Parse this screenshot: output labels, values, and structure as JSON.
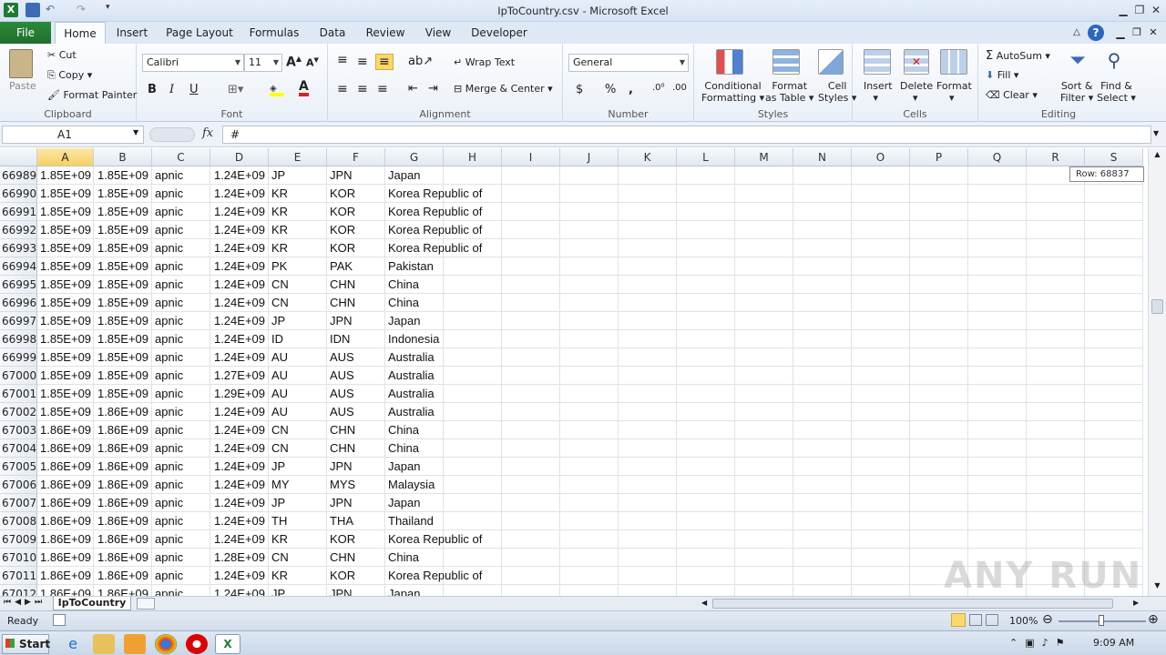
{
  "window": {
    "title": "IpToCountry.csv - Microsoft Excel"
  },
  "tabs": {
    "file": "File",
    "items": [
      "Home",
      "Insert",
      "Page Layout",
      "Formulas",
      "Data",
      "Review",
      "View",
      "Developer"
    ]
  },
  "ribbon": {
    "clipboard": {
      "label": "Clipboard",
      "paste": "Paste",
      "cut": "Cut",
      "copy": "Copy",
      "format_painter": "Format Painter"
    },
    "font": {
      "label": "Font",
      "family": "Calibri",
      "size": "11",
      "bold": "B",
      "italic": "I",
      "underline": "U"
    },
    "alignment": {
      "label": "Alignment",
      "wrap": "Wrap Text",
      "merge": "Merge & Center"
    },
    "number": {
      "label": "Number",
      "format": "General",
      "currency": "$",
      "percent": "%",
      "comma": ","
    },
    "styles": {
      "label": "Styles",
      "cond1": "Conditional",
      "cond2": "Formatting",
      "fmt1": "Format",
      "fmt2": "as Table",
      "cell1": "Cell",
      "cell2": "Styles"
    },
    "cells": {
      "label": "Cells",
      "insert": "Insert",
      "delete": "Delete",
      "format": "Format"
    },
    "editing": {
      "label": "Editing",
      "autosum": "AutoSum",
      "fill": "Fill",
      "clear": "Clear",
      "sort1": "Sort &",
      "sort2": "Filter",
      "find1": "Find &",
      "find2": "Select"
    }
  },
  "formula_bar": {
    "name_box": "A1",
    "fx": "fx",
    "content": "#"
  },
  "grid": {
    "columns": [
      "A",
      "B",
      "C",
      "D",
      "E",
      "F",
      "G",
      "H",
      "I",
      "J",
      "K",
      "L",
      "M",
      "N",
      "O",
      "P",
      "Q",
      "R",
      "S"
    ],
    "tooltip": "Row: 68837",
    "rows": [
      {
        "n": "66989",
        "a": "1.85E+09",
        "b": "1.85E+09",
        "c": "apnic",
        "d": "1.24E+09",
        "e": "JP",
        "f": "JPN",
        "g": "Japan"
      },
      {
        "n": "66990",
        "a": "1.85E+09",
        "b": "1.85E+09",
        "c": "apnic",
        "d": "1.24E+09",
        "e": "KR",
        "f": "KOR",
        "g": "Korea Republic of"
      },
      {
        "n": "66991",
        "a": "1.85E+09",
        "b": "1.85E+09",
        "c": "apnic",
        "d": "1.24E+09",
        "e": "KR",
        "f": "KOR",
        "g": "Korea Republic of"
      },
      {
        "n": "66992",
        "a": "1.85E+09",
        "b": "1.85E+09",
        "c": "apnic",
        "d": "1.24E+09",
        "e": "KR",
        "f": "KOR",
        "g": "Korea Republic of"
      },
      {
        "n": "66993",
        "a": "1.85E+09",
        "b": "1.85E+09",
        "c": "apnic",
        "d": "1.24E+09",
        "e": "KR",
        "f": "KOR",
        "g": "Korea Republic of"
      },
      {
        "n": "66994",
        "a": "1.85E+09",
        "b": "1.85E+09",
        "c": "apnic",
        "d": "1.24E+09",
        "e": "PK",
        "f": "PAK",
        "g": "Pakistan"
      },
      {
        "n": "66995",
        "a": "1.85E+09",
        "b": "1.85E+09",
        "c": "apnic",
        "d": "1.24E+09",
        "e": "CN",
        "f": "CHN",
        "g": "China"
      },
      {
        "n": "66996",
        "a": "1.85E+09",
        "b": "1.85E+09",
        "c": "apnic",
        "d": "1.24E+09",
        "e": "CN",
        "f": "CHN",
        "g": "China"
      },
      {
        "n": "66997",
        "a": "1.85E+09",
        "b": "1.85E+09",
        "c": "apnic",
        "d": "1.24E+09",
        "e": "JP",
        "f": "JPN",
        "g": "Japan"
      },
      {
        "n": "66998",
        "a": "1.85E+09",
        "b": "1.85E+09",
        "c": "apnic",
        "d": "1.24E+09",
        "e": "ID",
        "f": "IDN",
        "g": "Indonesia"
      },
      {
        "n": "66999",
        "a": "1.85E+09",
        "b": "1.85E+09",
        "c": "apnic",
        "d": "1.24E+09",
        "e": "AU",
        "f": "AUS",
        "g": "Australia"
      },
      {
        "n": "67000",
        "a": "1.85E+09",
        "b": "1.85E+09",
        "c": "apnic",
        "d": "1.27E+09",
        "e": "AU",
        "f": "AUS",
        "g": "Australia"
      },
      {
        "n": "67001",
        "a": "1.85E+09",
        "b": "1.85E+09",
        "c": "apnic",
        "d": "1.29E+09",
        "e": "AU",
        "f": "AUS",
        "g": "Australia"
      },
      {
        "n": "67002",
        "a": "1.85E+09",
        "b": "1.86E+09",
        "c": "apnic",
        "d": "1.24E+09",
        "e": "AU",
        "f": "AUS",
        "g": "Australia"
      },
      {
        "n": "67003",
        "a": "1.86E+09",
        "b": "1.86E+09",
        "c": "apnic",
        "d": "1.24E+09",
        "e": "CN",
        "f": "CHN",
        "g": "China"
      },
      {
        "n": "67004",
        "a": "1.86E+09",
        "b": "1.86E+09",
        "c": "apnic",
        "d": "1.24E+09",
        "e": "CN",
        "f": "CHN",
        "g": "China"
      },
      {
        "n": "67005",
        "a": "1.86E+09",
        "b": "1.86E+09",
        "c": "apnic",
        "d": "1.24E+09",
        "e": "JP",
        "f": "JPN",
        "g": "Japan"
      },
      {
        "n": "67006",
        "a": "1.86E+09",
        "b": "1.86E+09",
        "c": "apnic",
        "d": "1.24E+09",
        "e": "MY",
        "f": "MYS",
        "g": "Malaysia"
      },
      {
        "n": "67007",
        "a": "1.86E+09",
        "b": "1.86E+09",
        "c": "apnic",
        "d": "1.24E+09",
        "e": "JP",
        "f": "JPN",
        "g": "Japan"
      },
      {
        "n": "67008",
        "a": "1.86E+09",
        "b": "1.86E+09",
        "c": "apnic",
        "d": "1.24E+09",
        "e": "TH",
        "f": "THA",
        "g": "Thailand"
      },
      {
        "n": "67009",
        "a": "1.86E+09",
        "b": "1.86E+09",
        "c": "apnic",
        "d": "1.24E+09",
        "e": "KR",
        "f": "KOR",
        "g": "Korea Republic of"
      },
      {
        "n": "67010",
        "a": "1.86E+09",
        "b": "1.86E+09",
        "c": "apnic",
        "d": "1.28E+09",
        "e": "CN",
        "f": "CHN",
        "g": "China"
      },
      {
        "n": "67011",
        "a": "1.86E+09",
        "b": "1.86E+09",
        "c": "apnic",
        "d": "1.24E+09",
        "e": "KR",
        "f": "KOR",
        "g": "Korea Republic of"
      },
      {
        "n": "67012",
        "a": "1.86E+09",
        "b": "1.86E+09",
        "c": "apnic",
        "d": "1.24E+09",
        "e": "JP",
        "f": "JPN",
        "g": "Japan"
      }
    ]
  },
  "sheet": {
    "tab": "IpToCountry"
  },
  "status": {
    "ready": "Ready",
    "zoom": "100%"
  },
  "taskbar": {
    "start": "Start",
    "clock": "9:09 AM"
  },
  "watermark": "ANY RUN",
  "colors": {
    "excel_green": "#1e6e2b",
    "selected_header": "#f7cf63"
  }
}
